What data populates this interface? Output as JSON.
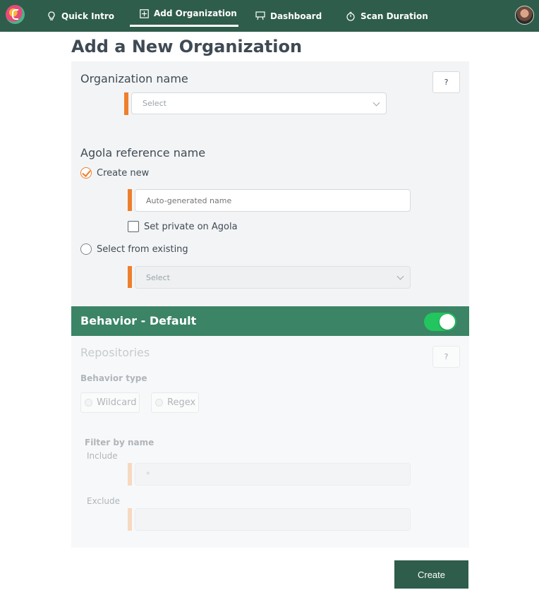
{
  "nav": {
    "items": [
      {
        "label": "Quick Intro",
        "icon": "lightbulb-icon"
      },
      {
        "label": "Add Organization",
        "icon": "plus-square-icon",
        "active": true
      },
      {
        "label": "Dashboard",
        "icon": "presentation-icon"
      },
      {
        "label": "Scan Duration",
        "icon": "stopwatch-icon"
      }
    ]
  },
  "page": {
    "title": "Add a New Organization"
  },
  "org": {
    "label": "Organization name",
    "help": "?",
    "select_placeholder": "Select"
  },
  "agola": {
    "label": "Agola reference name",
    "create_new": "Create new",
    "name_placeholder": "Auto-generated name",
    "private_label": "Set private on Agola",
    "select_existing": "Select from existing",
    "existing_placeholder": "Select"
  },
  "behavior": {
    "title": "Behavior - Default",
    "enabled": true,
    "repositories_label": "Repositories",
    "help": "?",
    "behavior_type_label": "Behavior type",
    "wildcard_label": "Wildcard",
    "regex_label": "Regex",
    "filter_label": "Filter by name",
    "include_label": "Include",
    "include_value": "*",
    "exclude_label": "Exclude",
    "exclude_value": ""
  },
  "actions": {
    "create_label": "Create"
  },
  "colors": {
    "nav_bg": "#2f5d4b",
    "accent_orange": "#ee7f2d",
    "behavior_bar": "#3b8466",
    "toggle_on": "#22c55e"
  }
}
